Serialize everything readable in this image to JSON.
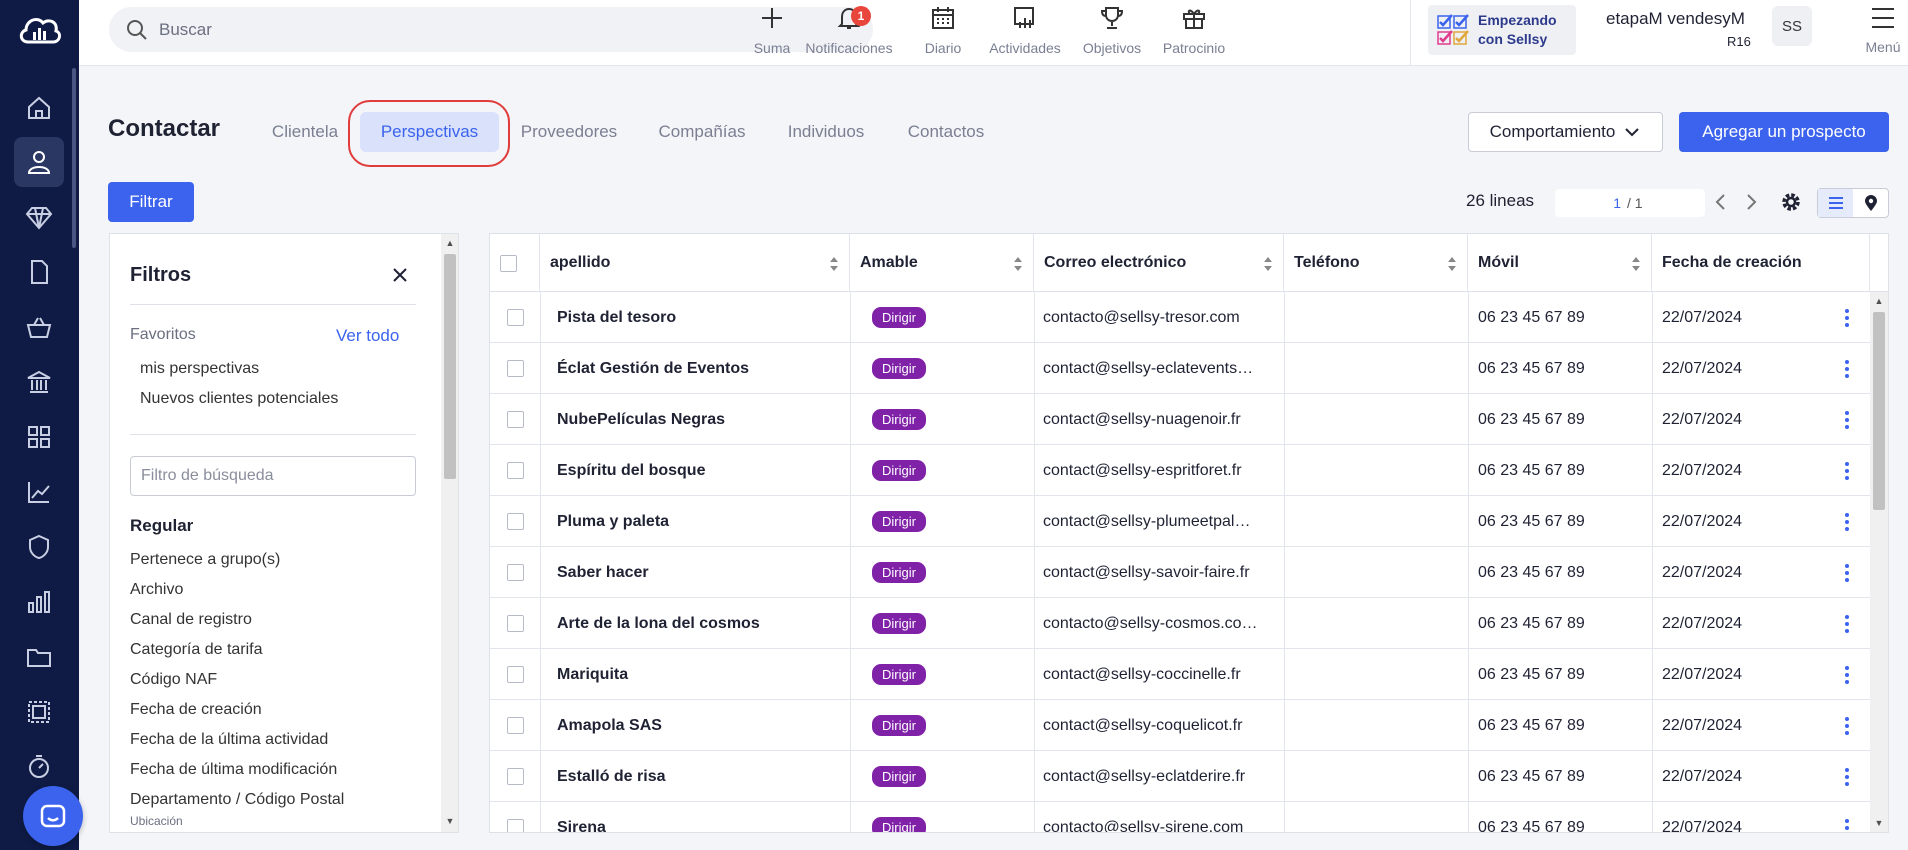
{
  "topbar": {
    "search_placeholder": "Buscar",
    "tools": [
      {
        "label": "Suma",
        "icon": "plus-icon"
      },
      {
        "label": "Notificaciones",
        "icon": "bell-icon",
        "badge": "1"
      },
      {
        "label": "Diario",
        "icon": "calendar-icon"
      },
      {
        "label": "Actividades",
        "icon": "activities-icon"
      },
      {
        "label": "Objetivos",
        "icon": "trophy-icon"
      },
      {
        "label": "Patrocinio",
        "icon": "gift-icon"
      }
    ],
    "starting_line1": "Empezando",
    "starting_line2": "con Sellsy",
    "user_name": "etapaM vendesyM",
    "user_sub": "R16",
    "avatar": "SS",
    "menu_label": "Menú"
  },
  "page": {
    "title": "Contactar",
    "tabs": [
      "Clientela",
      "Perspectivas",
      "Proveedores",
      "Compañías",
      "Individuos",
      "Contactos"
    ],
    "active_tab": "Perspectivas",
    "behavior_button": "Comportamiento",
    "add_button": "Agregar un prospecto",
    "filter_button": "Filtrar",
    "lines": "26 lineas",
    "page_current": "1",
    "page_total": "/ 1"
  },
  "filters": {
    "title": "Filtros",
    "favorites_label": "Favoritos",
    "see_all": "Ver todo",
    "favorites": [
      "mis perspectivas",
      "Nuevos clientes potenciales"
    ],
    "search_placeholder": "Filtro de búsqueda",
    "section": "Regular",
    "items": [
      "Pertenece a grupo(s)",
      "Archivo",
      "Canal de registro",
      "Categoría de tarifa",
      "Código NAF",
      "Fecha de creación",
      "Fecha de la última actividad",
      "Fecha de última modificación",
      "Departamento / Código Postal"
    ],
    "last_sub": "Ubicación"
  },
  "table": {
    "columns": [
      "apellido",
      "Amable",
      "Correo electrónico",
      "Teléfono",
      "Móvil",
      "Fecha de creación"
    ],
    "rows": [
      {
        "name": "Pista del tesoro",
        "type": "Dirigir",
        "email": "contacto@sellsy-tresor.com",
        "phone": "",
        "mobile": "06 23 45 67 89",
        "date": "22/07/2024"
      },
      {
        "name": "Éclat Gestión de Eventos",
        "type": "Dirigir",
        "email": "contact@sellsy-eclatevents…",
        "phone": "",
        "mobile": "06 23 45 67 89",
        "date": "22/07/2024"
      },
      {
        "name": "NubePelículas Negras",
        "type": "Dirigir",
        "email": "contact@sellsy-nuagenoir.fr",
        "phone": "",
        "mobile": "06 23 45 67 89",
        "date": "22/07/2024"
      },
      {
        "name": "Espíritu del bosque",
        "type": "Dirigir",
        "email": "contact@sellsy-espritforet.fr",
        "phone": "",
        "mobile": "06 23 45 67 89",
        "date": "22/07/2024"
      },
      {
        "name": "Pluma y paleta",
        "type": "Dirigir",
        "email": "contact@sellsy-plumeetpal…",
        "phone": "",
        "mobile": "06 23 45 67 89",
        "date": "22/07/2024"
      },
      {
        "name": "Saber hacer",
        "type": "Dirigir",
        "email": "contact@sellsy-savoir-faire.fr",
        "phone": "",
        "mobile": "06 23 45 67 89",
        "date": "22/07/2024"
      },
      {
        "name": "Arte de la lona del cosmos",
        "type": "Dirigir",
        "email": "contacto@sellsy-cosmos.co…",
        "phone": "",
        "mobile": "06 23 45 67 89",
        "date": "22/07/2024"
      },
      {
        "name": "Mariquita",
        "type": "Dirigir",
        "email": "contact@sellsy-coccinelle.fr",
        "phone": "",
        "mobile": "06 23 45 67 89",
        "date": "22/07/2024"
      },
      {
        "name": "Amapola SAS",
        "type": "Dirigir",
        "email": "contact@sellsy-coquelicot.fr",
        "phone": "",
        "mobile": "06 23 45 67 89",
        "date": "22/07/2024"
      },
      {
        "name": "Estalló de risa",
        "type": "Dirigir",
        "email": "contact@sellsy-eclatderire.fr",
        "phone": "",
        "mobile": "06 23 45 67 89",
        "date": "22/07/2024"
      },
      {
        "name": "Sirena",
        "type": "Dirigir",
        "email": "contacto@sellsy-sirene.com",
        "phone": "",
        "mobile": "06 23 45 67 89",
        "date": "22/07/2024"
      }
    ]
  },
  "colors": {
    "accent": "#3b63ed",
    "sidebar": "#0f1b45",
    "tag": "#7f22a8",
    "highlight_ring": "#e03c3c"
  }
}
